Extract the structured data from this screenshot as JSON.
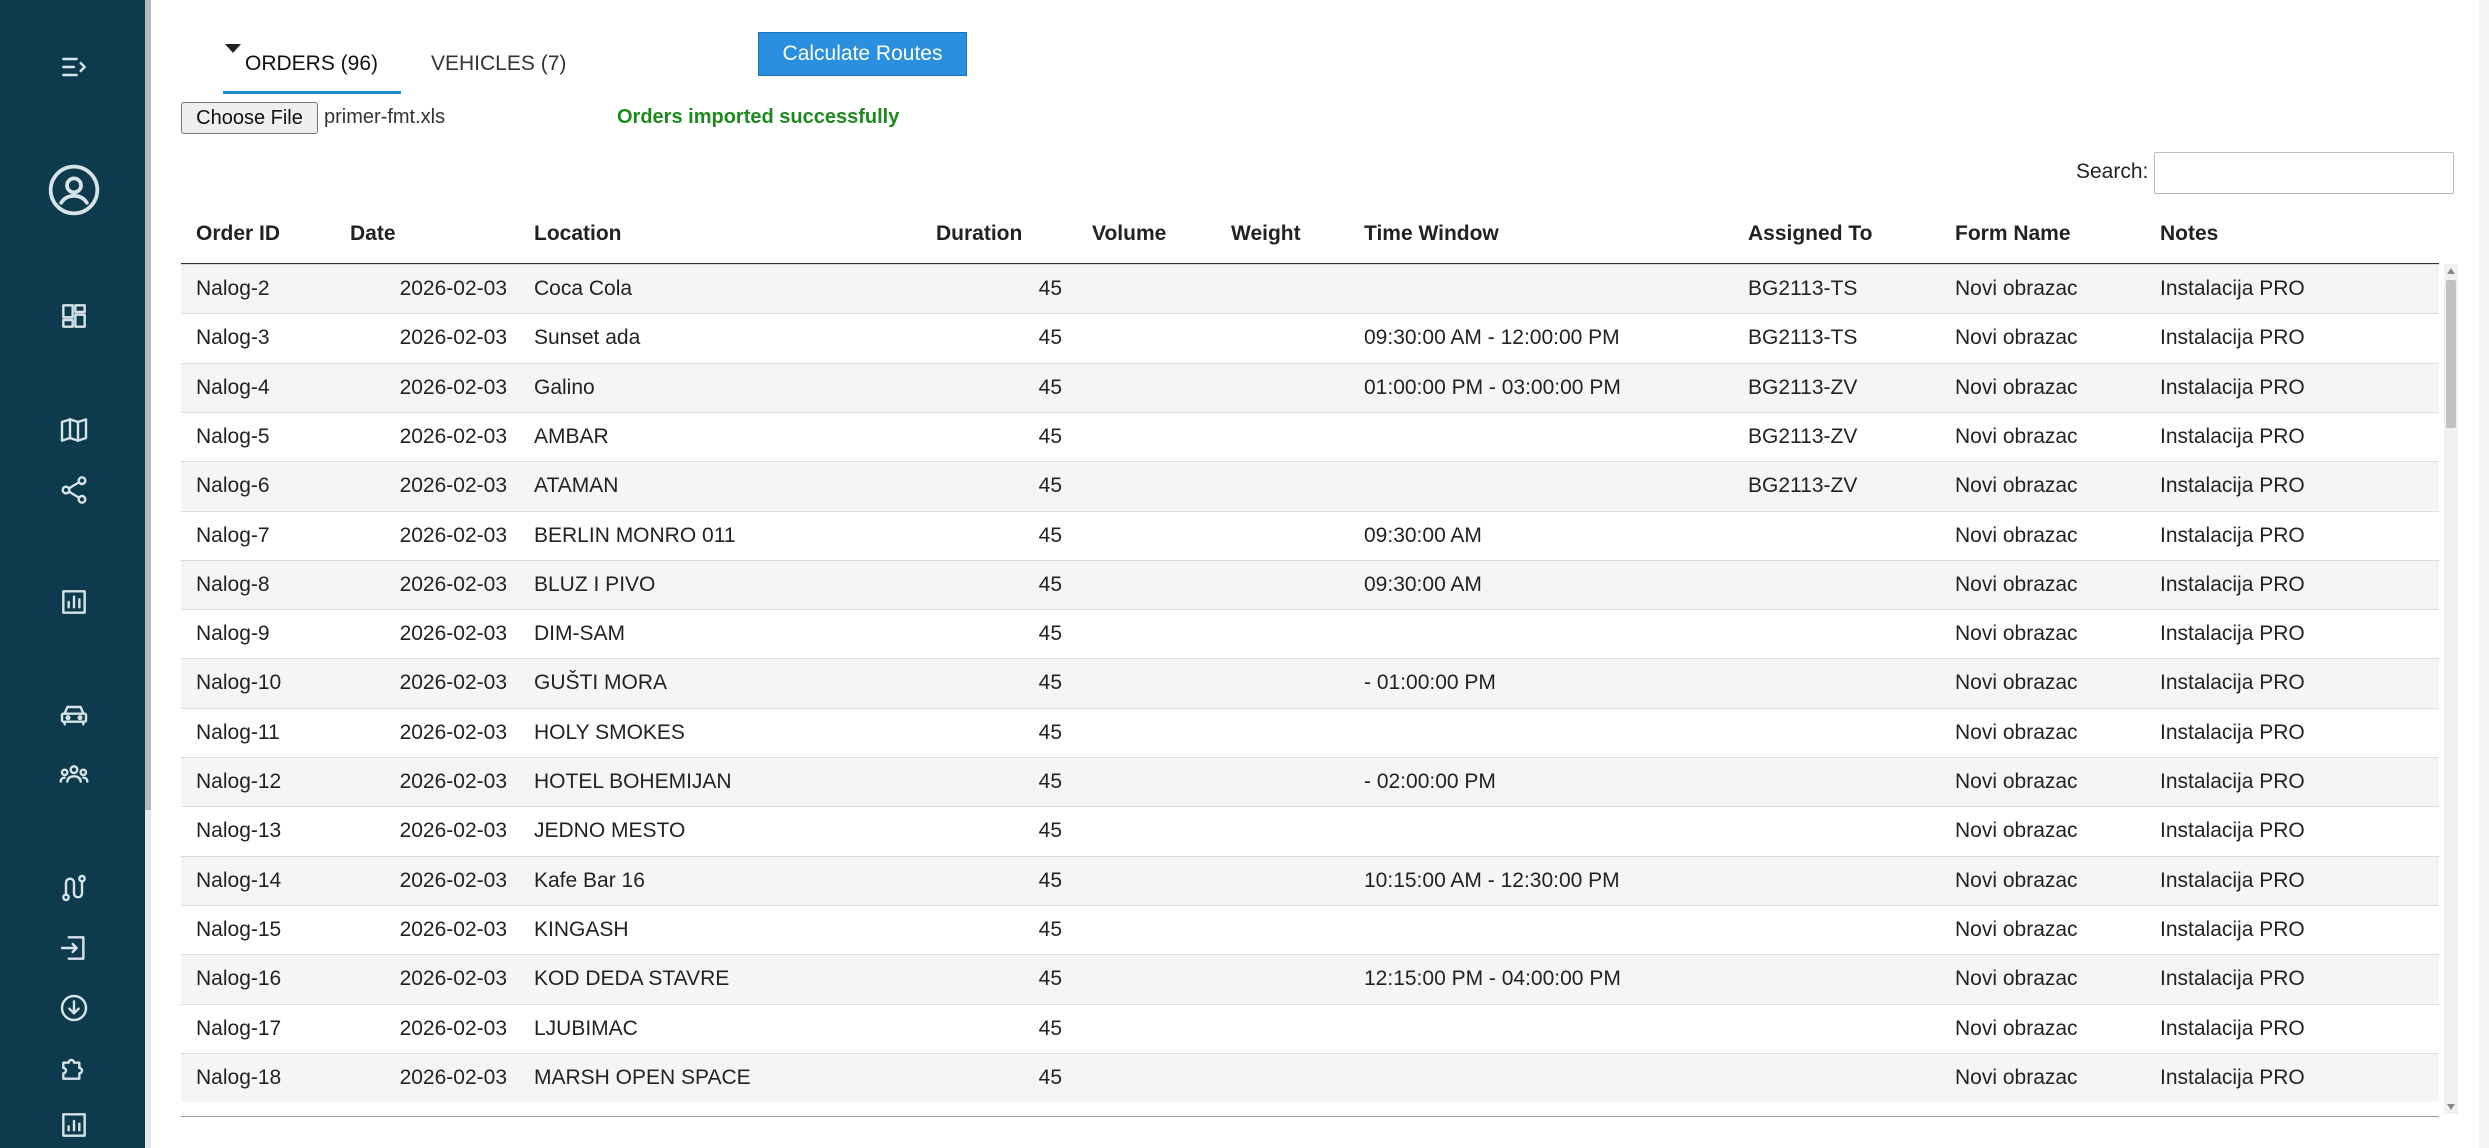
{
  "sidebar": {
    "icons": [
      {
        "name": "menu-collapse-icon"
      },
      {
        "name": "user-profile-icon"
      },
      {
        "name": "dashboard-icon"
      },
      {
        "name": "map-icon"
      },
      {
        "name": "share-icon"
      },
      {
        "name": "analytics-icon"
      },
      {
        "name": "car-icon"
      },
      {
        "name": "team-icon"
      },
      {
        "name": "route-icon"
      },
      {
        "name": "import-icon"
      },
      {
        "name": "download-icon"
      },
      {
        "name": "extension-icon"
      },
      {
        "name": "report-icon"
      }
    ]
  },
  "tabs": [
    {
      "label": "ORDERS (96)",
      "active": true
    },
    {
      "label": "VEHICLES (7)",
      "active": false
    }
  ],
  "toolbar": {
    "calculate_label": "Calculate Routes",
    "choose_file_label": "Choose File",
    "file_name": "primer-fmt.xls",
    "import_status": "Orders imported successfully"
  },
  "search": {
    "label": "Search:",
    "value": ""
  },
  "table": {
    "columns": [
      "Order ID",
      "Date",
      "Location",
      "Duration",
      "Volume",
      "Weight",
      "Time Window",
      "Assigned To",
      "Form Name",
      "Notes"
    ],
    "rows": [
      {
        "id": "Nalog-2",
        "date": "2026-02-03",
        "location": "Coca Cola",
        "duration": "45",
        "volume": "",
        "weight": "",
        "time_window": "",
        "assigned_to": "BG2113-TS",
        "form_name": "Novi obrazac",
        "notes": "Instalacija PRO"
      },
      {
        "id": "Nalog-3",
        "date": "2026-02-03",
        "location": "Sunset ada",
        "duration": "45",
        "volume": "",
        "weight": "",
        "time_window": "09:30:00 AM - 12:00:00 PM",
        "assigned_to": "BG2113-TS",
        "form_name": "Novi obrazac",
        "notes": "Instalacija PRO"
      },
      {
        "id": "Nalog-4",
        "date": "2026-02-03",
        "location": "Galino",
        "duration": "45",
        "volume": "",
        "weight": "",
        "time_window": "01:00:00 PM - 03:00:00 PM",
        "assigned_to": "BG2113-ZV",
        "form_name": "Novi obrazac",
        "notes": "Instalacija PRO"
      },
      {
        "id": "Nalog-5",
        "date": "2026-02-03",
        "location": "AMBAR",
        "duration": "45",
        "volume": "",
        "weight": "",
        "time_window": "",
        "assigned_to": "BG2113-ZV",
        "form_name": "Novi obrazac",
        "notes": "Instalacija PRO"
      },
      {
        "id": "Nalog-6",
        "date": "2026-02-03",
        "location": "ATAMAN",
        "duration": "45",
        "volume": "",
        "weight": "",
        "time_window": "",
        "assigned_to": "BG2113-ZV",
        "form_name": "Novi obrazac",
        "notes": "Instalacija PRO"
      },
      {
        "id": "Nalog-7",
        "date": "2026-02-03",
        "location": "BERLIN MONRO 011",
        "duration": "45",
        "volume": "",
        "weight": "",
        "time_window": "09:30:00 AM",
        "assigned_to": "",
        "form_name": "Novi obrazac",
        "notes": "Instalacija PRO"
      },
      {
        "id": "Nalog-8",
        "date": "2026-02-03",
        "location": "BLUZ I PIVO",
        "duration": "45",
        "volume": "",
        "weight": "",
        "time_window": "09:30:00 AM",
        "assigned_to": "",
        "form_name": "Novi obrazac",
        "notes": "Instalacija PRO"
      },
      {
        "id": "Nalog-9",
        "date": "2026-02-03",
        "location": "DIM-SAM",
        "duration": "45",
        "volume": "",
        "weight": "",
        "time_window": "",
        "assigned_to": "",
        "form_name": "Novi obrazac",
        "notes": "Instalacija PRO"
      },
      {
        "id": "Nalog-10",
        "date": "2026-02-03",
        "location": "GUŠTI MORA",
        "duration": "45",
        "volume": "",
        "weight": "",
        "time_window": "- 01:00:00 PM",
        "assigned_to": "",
        "form_name": "Novi obrazac",
        "notes": "Instalacija PRO"
      },
      {
        "id": "Nalog-11",
        "date": "2026-02-03",
        "location": "HOLY SMOKES",
        "duration": "45",
        "volume": "",
        "weight": "",
        "time_window": "",
        "assigned_to": "",
        "form_name": "Novi obrazac",
        "notes": "Instalacija PRO"
      },
      {
        "id": "Nalog-12",
        "date": "2026-02-03",
        "location": "HOTEL BOHEMIJAN",
        "duration": "45",
        "volume": "",
        "weight": "",
        "time_window": "- 02:00:00 PM",
        "assigned_to": "",
        "form_name": "Novi obrazac",
        "notes": "Instalacija PRO"
      },
      {
        "id": "Nalog-13",
        "date": "2026-02-03",
        "location": "JEDNO MESTO",
        "duration": "45",
        "volume": "",
        "weight": "",
        "time_window": "",
        "assigned_to": "",
        "form_name": "Novi obrazac",
        "notes": "Instalacija PRO"
      },
      {
        "id": "Nalog-14",
        "date": "2026-02-03",
        "location": "Kafe Bar 16",
        "duration": "45",
        "volume": "",
        "weight": "",
        "time_window": "10:15:00 AM - 12:30:00 PM",
        "assigned_to": "",
        "form_name": "Novi obrazac",
        "notes": "Instalacija PRO"
      },
      {
        "id": "Nalog-15",
        "date": "2026-02-03",
        "location": "KINGASH",
        "duration": "45",
        "volume": "",
        "weight": "",
        "time_window": "",
        "assigned_to": "",
        "form_name": "Novi obrazac",
        "notes": "Instalacija PRO"
      },
      {
        "id": "Nalog-16",
        "date": "2026-02-03",
        "location": "KOD DEDA STAVRE",
        "duration": "45",
        "volume": "",
        "weight": "",
        "time_window": "12:15:00 PM - 04:00:00 PM",
        "assigned_to": "",
        "form_name": "Novi obrazac",
        "notes": "Instalacija PRO"
      },
      {
        "id": "Nalog-17",
        "date": "2026-02-03",
        "location": "LJUBIMAC",
        "duration": "45",
        "volume": "",
        "weight": "",
        "time_window": "",
        "assigned_to": "",
        "form_name": "Novi obrazac",
        "notes": "Instalacija PRO"
      },
      {
        "id": "Nalog-18",
        "date": "2026-02-03",
        "location": "MARSH OPEN SPACE",
        "duration": "45",
        "volume": "",
        "weight": "",
        "time_window": "",
        "assigned_to": "",
        "form_name": "Novi obrazac",
        "notes": "Instalacija PRO"
      }
    ]
  }
}
